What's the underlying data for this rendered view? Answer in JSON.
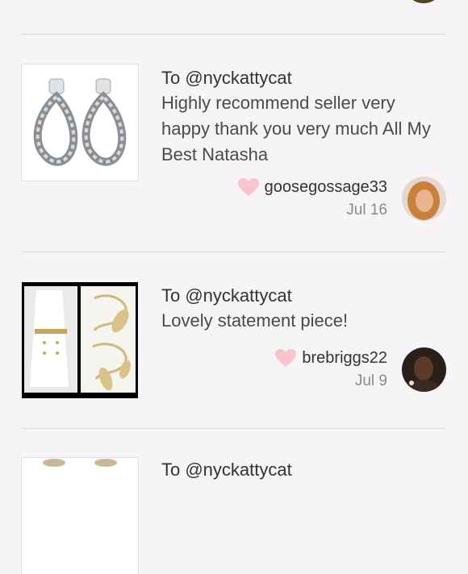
{
  "reviews": [
    {
      "to": "To @nyckattycat",
      "message": "Highly recommend seller very happy thank you very much All My Best Natasha",
      "username": "goosegossage33",
      "date": "Jul 16",
      "thumb_icon": "rhinestone-earrings",
      "avatar_color": "#c9803a"
    },
    {
      "to": "To @nyckattycat",
      "message": "Lovely statement piece!",
      "username": "brebriggs22",
      "date": "Jul 9",
      "thumb_icon": "gold-leaf-belt",
      "avatar_color": "#2a1e18"
    },
    {
      "to": "To @nyckattycat"
    }
  ],
  "colors": {
    "heart": "#f7c3cc",
    "divider": "#d9d6d9",
    "background": "#f6f4f6"
  }
}
